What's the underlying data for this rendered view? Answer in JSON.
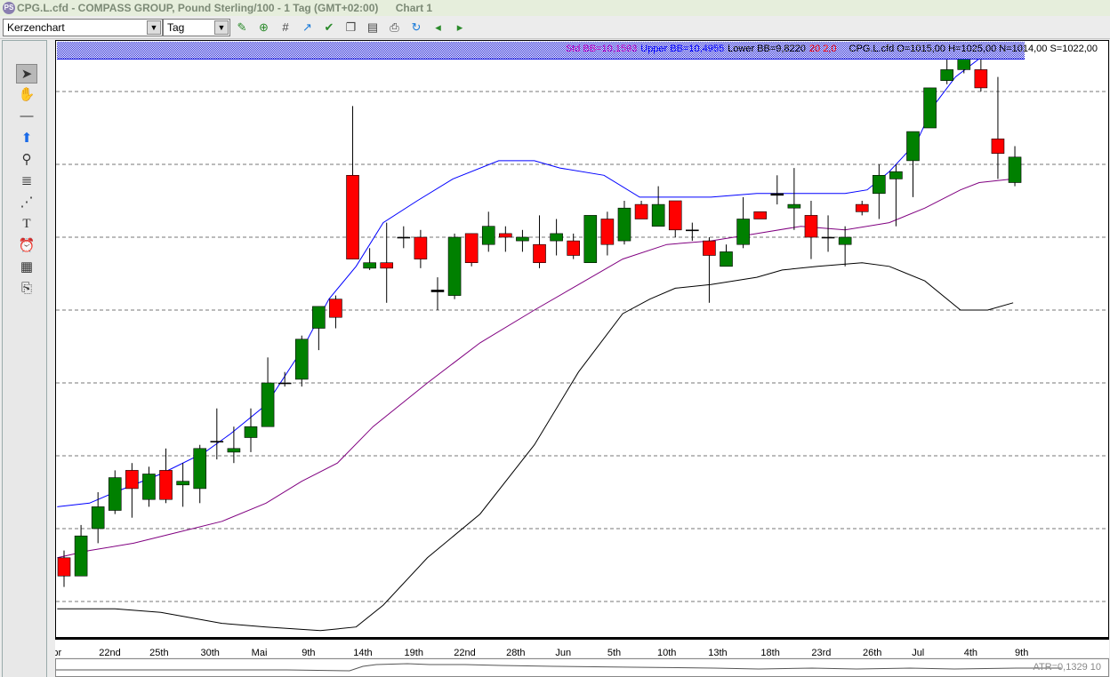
{
  "window": {
    "title": "CPG.L.cfd - COMPASS GROUP, Pound Sterling/100 - 1 Tag (GMT+02:00)",
    "chart_name": "Chart 1",
    "logo": "PS"
  },
  "toolbar": {
    "chart_type": "Kerzenchart",
    "period": "Tag",
    "icons": [
      "add-instrument-icon",
      "add-comparison-icon",
      "grid-icon",
      "indicator-icon",
      "apply-indicator-icon",
      "templates-icon",
      "document-icon",
      "print-icon",
      "refresh-icon",
      "back-icon",
      "forward-icon"
    ]
  },
  "left_tools": [
    "cursor-icon",
    "hand-pan-icon",
    "line-tool-icon",
    "arrow-tool-icon",
    "zoom-tool-icon",
    "fibonacci-icon",
    "fan-tool-icon",
    "text-tool-icon",
    "alarm-icon",
    "calculator-icon",
    "export-icon"
  ],
  "info": {
    "std": "Std BB=10,1593",
    "upper": "Upper BB=10,4955",
    "lower": "Lower BB=9,8220",
    "params": "20 2,0",
    "ohlc": "CPG.L.cfd O=1015,00 H=1025,00 N=1014,00 S=1022,00"
  },
  "atr": {
    "label": "ATR=0,1329  10"
  },
  "colors": {
    "up": "#008000",
    "down": "#ff0000",
    "upper": "#0000ff",
    "middle": "#800080",
    "lower": "#000000"
  },
  "chart_data": {
    "type": "candlestick",
    "title": "CPG.L.cfd - COMPASS GROUP",
    "yrange": [
      8.88,
      10.53
    ],
    "grid_y": [
      10.4,
      10.2,
      10.0,
      9.8,
      9.6,
      9.4,
      9.2,
      9.0
    ],
    "xticks": [
      {
        "i": -0.6,
        "label": "Apr"
      },
      {
        "i": 2.7,
        "label": "22nd"
      },
      {
        "i": 5.6,
        "label": "25th"
      },
      {
        "i": 8.6,
        "label": "30th"
      },
      {
        "i": 11.5,
        "label": "Mai"
      },
      {
        "i": 14.4,
        "label": "9th"
      },
      {
        "i": 17.6,
        "label": "14th"
      },
      {
        "i": 20.6,
        "label": "19th"
      },
      {
        "i": 23.6,
        "label": "22nd"
      },
      {
        "i": 26.6,
        "label": "28th"
      },
      {
        "i": 29.4,
        "label": "Jun"
      },
      {
        "i": 32.4,
        "label": "5th"
      },
      {
        "i": 35.5,
        "label": "10th"
      },
      {
        "i": 38.5,
        "label": "13th"
      },
      {
        "i": 41.6,
        "label": "18th"
      },
      {
        "i": 44.6,
        "label": "23rd"
      },
      {
        "i": 47.6,
        "label": "26th"
      },
      {
        "i": 50.3,
        "label": "Jul"
      },
      {
        "i": 53.4,
        "label": "4th"
      },
      {
        "i": 56.4,
        "label": "9th"
      }
    ],
    "candles_ohlc": [
      [
        9.12,
        9.14,
        9.04,
        9.07
      ],
      [
        9.07,
        9.21,
        9.07,
        9.18
      ],
      [
        9.2,
        9.3,
        9.16,
        9.26
      ],
      [
        9.25,
        9.36,
        9.24,
        9.34
      ],
      [
        9.36,
        9.38,
        9.23,
        9.31
      ],
      [
        9.28,
        9.37,
        9.26,
        9.35
      ],
      [
        9.36,
        9.42,
        9.27,
        9.28
      ],
      [
        9.32,
        9.38,
        9.26,
        9.33
      ],
      [
        9.31,
        9.43,
        9.27,
        9.42
      ],
      [
        9.44,
        9.53,
        9.39,
        9.44
      ],
      [
        9.41,
        9.48,
        9.38,
        9.42
      ],
      [
        9.45,
        9.53,
        9.41,
        9.48
      ],
      [
        9.48,
        9.67,
        9.48,
        9.6
      ],
      [
        9.6,
        9.63,
        9.59,
        9.6
      ],
      [
        9.61,
        9.73,
        9.59,
        9.72
      ],
      [
        9.75,
        9.81,
        9.69,
        9.81
      ],
      [
        9.83,
        9.84,
        9.75,
        9.78
      ],
      [
        10.17,
        10.36,
        9.94,
        9.94
      ],
      [
        9.915,
        9.97,
        9.91,
        9.93
      ],
      [
        9.93,
        10.04,
        9.82,
        9.915
      ],
      [
        10.0,
        10.03,
        9.97,
        10.0
      ],
      [
        10.0,
        10.02,
        9.915,
        9.94
      ],
      [
        9.85,
        9.89,
        9.8,
        9.855
      ],
      [
        9.84,
        10.01,
        9.83,
        10.0
      ],
      [
        10.01,
        10.01,
        9.92,
        9.93
      ],
      [
        9.98,
        10.07,
        9.96,
        10.03
      ],
      [
        10.01,
        10.03,
        9.96,
        10.0
      ],
      [
        9.99,
        10.02,
        9.96,
        10.0
      ],
      [
        9.98,
        10.06,
        9.915,
        9.93
      ],
      [
        9.99,
        10.05,
        9.95,
        10.01
      ],
      [
        9.99,
        10.01,
        9.94,
        9.95
      ],
      [
        9.93,
        10.06,
        9.93,
        10.06
      ],
      [
        10.05,
        10.07,
        9.95,
        9.98
      ],
      [
        9.99,
        10.1,
        9.98,
        10.08
      ],
      [
        10.09,
        10.1,
        10.05,
        10.05
      ],
      [
        10.03,
        10.14,
        10.03,
        10.09
      ],
      [
        10.1,
        10.1,
        10.0,
        10.02
      ],
      [
        10.02,
        10.04,
        9.99,
        10.02
      ],
      [
        9.99,
        10.0,
        9.82,
        9.95
      ],
      [
        9.92,
        9.98,
        9.92,
        9.96
      ],
      [
        9.98,
        10.11,
        9.97,
        10.05
      ],
      [
        10.07,
        10.07,
        10.05,
        10.05
      ],
      [
        10.12,
        10.17,
        10.09,
        10.115
      ],
      [
        10.08,
        10.19,
        10.02,
        10.09
      ],
      [
        10.06,
        10.1,
        9.94,
        10.0
      ],
      [
        10.0,
        10.06,
        9.96,
        10.0
      ],
      [
        9.98,
        10.03,
        9.92,
        10.0
      ],
      [
        10.09,
        10.1,
        10.06,
        10.07
      ],
      [
        10.12,
        10.2,
        10.05,
        10.17
      ],
      [
        10.16,
        10.2,
        10.03,
        10.18
      ],
      [
        10.21,
        10.29,
        10.11,
        10.29
      ],
      [
        10.3,
        10.41,
        10.3,
        10.41
      ],
      [
        10.43,
        10.49,
        10.42,
        10.46
      ],
      [
        10.46,
        10.5,
        10.45,
        10.49
      ],
      [
        10.46,
        10.49,
        10.4,
        10.41
      ],
      [
        10.27,
        10.44,
        10.16,
        10.23
      ],
      [
        10.15,
        10.25,
        10.14,
        10.22
      ]
    ],
    "bollinger": {
      "period": 20,
      "deviation": 2.0,
      "upper": [
        [
          -0.4,
          9.26
        ],
        [
          1.5,
          9.27
        ],
        [
          3.0,
          9.3
        ],
        [
          5.7,
          9.35
        ],
        [
          8.3,
          9.41
        ],
        [
          9.8,
          9.46
        ],
        [
          11.9,
          9.54
        ],
        [
          14.0,
          9.69
        ],
        [
          15.6,
          9.83
        ],
        [
          17.2,
          9.92
        ],
        [
          18.8,
          10.04
        ],
        [
          20.8,
          10.1
        ],
        [
          22.9,
          10.16
        ],
        [
          25.6,
          10.21
        ],
        [
          27.7,
          10.21
        ],
        [
          29.2,
          10.19
        ],
        [
          31.8,
          10.17
        ],
        [
          33.9,
          10.11
        ],
        [
          36.0,
          10.11
        ],
        [
          38.1,
          10.11
        ],
        [
          40.8,
          10.12
        ],
        [
          43.4,
          10.12
        ],
        [
          46.0,
          10.12
        ],
        [
          47.3,
          10.13
        ],
        [
          48.6,
          10.18
        ],
        [
          50.2,
          10.26
        ],
        [
          51.2,
          10.36
        ],
        [
          52.5,
          10.44
        ],
        [
          53.9,
          10.49
        ],
        [
          56.5,
          10.49
        ]
      ],
      "middle": [
        [
          -0.4,
          9.12
        ],
        [
          1.5,
          9.14
        ],
        [
          4.1,
          9.16
        ],
        [
          6.7,
          9.19
        ],
        [
          9.3,
          9.22
        ],
        [
          11.9,
          9.27
        ],
        [
          14.0,
          9.33
        ],
        [
          16.1,
          9.38
        ],
        [
          18.2,
          9.48
        ],
        [
          21.4,
          9.6
        ],
        [
          24.5,
          9.71
        ],
        [
          27.7,
          9.8
        ],
        [
          30.3,
          9.87
        ],
        [
          32.9,
          9.94
        ],
        [
          35.5,
          9.98
        ],
        [
          38.1,
          9.99
        ],
        [
          40.8,
          10.01
        ],
        [
          43.4,
          10.03
        ],
        [
          46.0,
          10.02
        ],
        [
          48.6,
          10.04
        ],
        [
          50.7,
          10.08
        ],
        [
          52.8,
          10.13
        ],
        [
          53.9,
          10.15
        ],
        [
          55.9,
          10.16
        ]
      ],
      "lower": [
        [
          -0.4,
          8.98
        ],
        [
          3.0,
          8.98
        ],
        [
          5.7,
          8.97
        ],
        [
          9.3,
          8.94
        ],
        [
          11.9,
          8.93
        ],
        [
          15.1,
          8.92
        ],
        [
          17.2,
          8.93
        ],
        [
          18.8,
          8.99
        ],
        [
          21.4,
          9.12
        ],
        [
          24.5,
          9.24
        ],
        [
          27.7,
          9.43
        ],
        [
          30.3,
          9.63
        ],
        [
          32.9,
          9.79
        ],
        [
          34.5,
          9.83
        ],
        [
          36.0,
          9.86
        ],
        [
          38.1,
          9.87
        ],
        [
          40.8,
          9.89
        ],
        [
          42.3,
          9.91
        ],
        [
          44.4,
          9.92
        ],
        [
          47.0,
          9.93
        ],
        [
          48.6,
          9.92
        ],
        [
          50.7,
          9.88
        ],
        [
          52.8,
          9.8
        ],
        [
          54.4,
          9.8
        ],
        [
          55.9,
          9.82
        ]
      ]
    }
  }
}
